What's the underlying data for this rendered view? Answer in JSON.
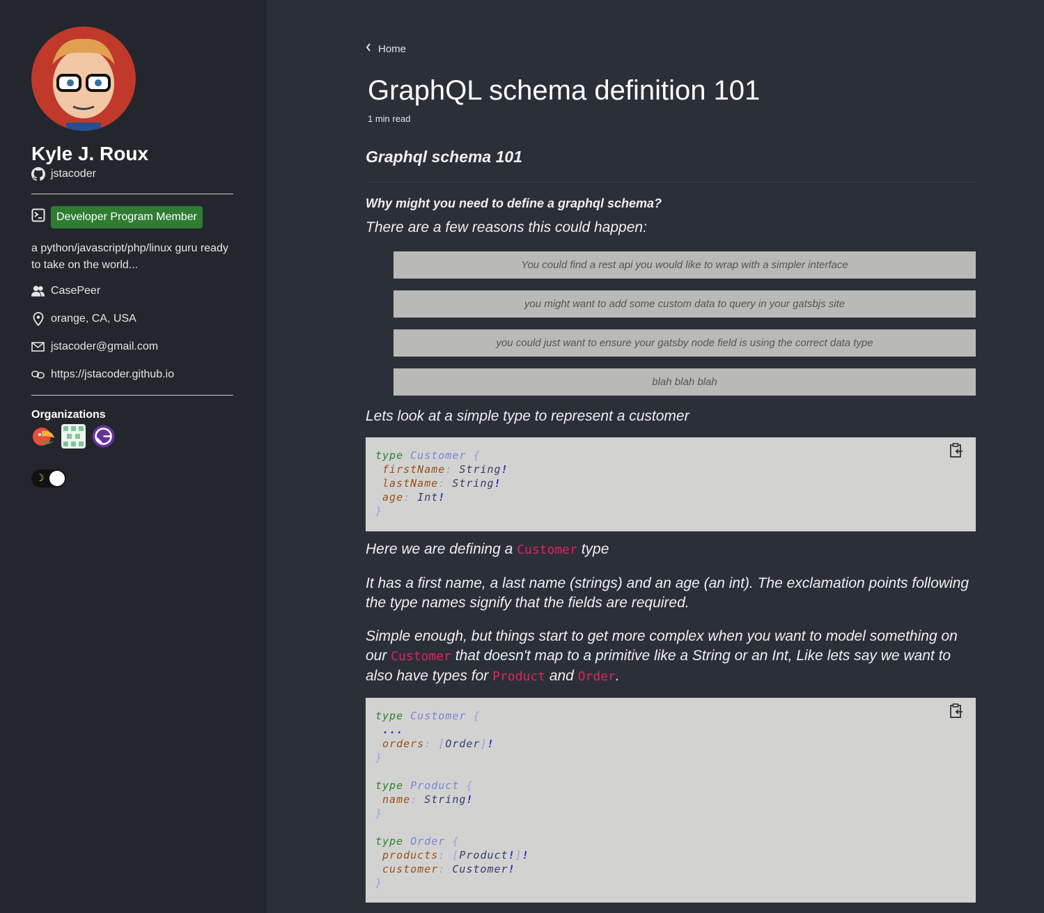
{
  "profile": {
    "name": "Kyle J. Roux",
    "handle": "jstacoder",
    "badge": "Developer Program Member",
    "bio": "a python/javascript/php/linux guru ready to take on the world...",
    "company": "CasePeer",
    "location": "orange, CA, USA",
    "email": "jstacoder@gmail.com",
    "website": "https://jstacoder.github.io",
    "orgs_title": "Organizations"
  },
  "nav": {
    "back_label": "Home"
  },
  "post": {
    "title": "GraphQL schema definition 101",
    "read_time": "1 min read",
    "h2": "Graphql schema 101",
    "h4": "Why might you need to define a graphql schema?",
    "p1": "There are a few reasons this could happen:",
    "reasons": [
      "You could find a rest api you would like to wrap with a simpler interface",
      "you might want to add some custom data to query in your gatsbjs site",
      "you could just want to ensure your gatsby node field is using the correct data type",
      "blah blah blah"
    ],
    "p2": "Lets look at a simple type to represent a customer",
    "p3_pre": "Here we are defining a",
    "p3_code": "Customer",
    "p3_post": "type",
    "p4": "It has a first name, a last name (strings) and an age (an int). The exclamation points following the type names signify that the fields are required.",
    "p5_a": "Simple enough, but things start to get more complex when you want to model something on our",
    "p5_code1": "Customer",
    "p5_b": "that doesn't map to a primitive like a String or an Int, Like lets say we want to also have types for",
    "p5_code2": "Product",
    "p5_c": "and",
    "p5_code3": "Order",
    "p5_d": "."
  },
  "code": {
    "kw_type": "type",
    "t_customer": "Customer",
    "t_product": "Product",
    "t_order": "Order",
    "f_first": "firstName",
    "f_last": "lastName",
    "f_age": "age",
    "f_orders": "orders",
    "f_name": "name",
    "f_products": "products",
    "f_customer": "customer",
    "ty_string": "String",
    "ty_int": "Int",
    "ty_order": "Order",
    "ty_product": "Product",
    "ty_customer": "Customer",
    "ellipsis": "..."
  }
}
